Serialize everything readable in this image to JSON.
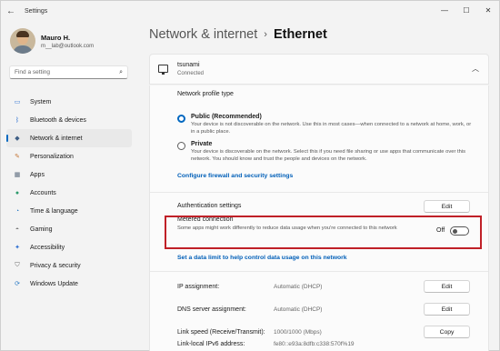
{
  "window": {
    "title": "Settings",
    "controls": {
      "minimize": "—",
      "maximize": "☐",
      "close": "✕"
    }
  },
  "profile": {
    "name": "Mauro H.",
    "email": "m__lab@outlook.com"
  },
  "search": {
    "placeholder": "Find a setting"
  },
  "sidebar": {
    "items": [
      {
        "label": "System",
        "icon": "system-icon",
        "glyph": "▭",
        "color": "#3a7bd5"
      },
      {
        "label": "Bluetooth & devices",
        "icon": "bluetooth-icon",
        "glyph": "ᛒ",
        "color": "#2b6fd1"
      },
      {
        "label": "Network & internet",
        "icon": "wifi-icon",
        "glyph": "◆",
        "color": "#3e5e85",
        "active": true
      },
      {
        "label": "Personalization",
        "icon": "brush-icon",
        "glyph": "✎",
        "color": "#c5783a"
      },
      {
        "label": "Apps",
        "icon": "apps-icon",
        "glyph": "▦",
        "color": "#5b6b7d"
      },
      {
        "label": "Accounts",
        "icon": "person-icon",
        "glyph": "●",
        "color": "#2c9a6c"
      },
      {
        "label": "Time & language",
        "icon": "globe-clock-icon",
        "glyph": "◔",
        "color": "#2a79c4"
      },
      {
        "label": "Gaming",
        "icon": "gamepad-icon",
        "glyph": "◓",
        "color": "#7b7b7b"
      },
      {
        "label": "Accessibility",
        "icon": "accessibility-icon",
        "glyph": "✦",
        "color": "#2c6ed1"
      },
      {
        "label": "Privacy & security",
        "icon": "shield-icon",
        "glyph": "⛉",
        "color": "#6b6b6b"
      },
      {
        "label": "Windows Update",
        "icon": "update-icon",
        "glyph": "⟳",
        "color": "#2a79c4"
      }
    ]
  },
  "breadcrumb": {
    "parent": "Network & internet",
    "separator": "›",
    "current": "Ethernet"
  },
  "network": {
    "name": "tsunami",
    "status": "Connected"
  },
  "profile_type": {
    "label": "Network profile type",
    "options": [
      {
        "title": "Public (Recommended)",
        "desc": "Your device is not discoverable on the network. Use this in most cases—when connected to a network at home, work, or in a public place.",
        "checked": true
      },
      {
        "title": "Private",
        "desc": "Your device is discoverable on the network. Select this if you need file sharing or use apps that communicate over this network. You should know and trust the people and devices on the network.",
        "checked": false
      }
    ],
    "firewall_link": "Configure firewall and security settings"
  },
  "auth": {
    "label": "Authentication settings",
    "button": "Edit"
  },
  "metered": {
    "title": "Metered connection",
    "desc": "Some apps might work differently to reduce data usage when you're connected to this network",
    "toggle_label": "Off",
    "data_limit_link": "Set a data limit to help control data usage on this network"
  },
  "ip": {
    "label": "IP assignment:",
    "value": "Automatic (DHCP)",
    "button": "Edit"
  },
  "dns": {
    "label": "DNS server assignment:",
    "value": "Automatic (DHCP)",
    "button": "Edit"
  },
  "link_speed": {
    "label": "Link speed (Receive/Transmit):",
    "value": "1000/1000 (Mbps)",
    "button": "Copy"
  },
  "ipv6": {
    "label": "Link-local IPv6 address:",
    "value": "fe80::e93a:8dfb:c338:570f%19"
  },
  "colors": {
    "accent": "#0067c0",
    "highlight_border": "#c02027",
    "link": "#005fb8"
  }
}
